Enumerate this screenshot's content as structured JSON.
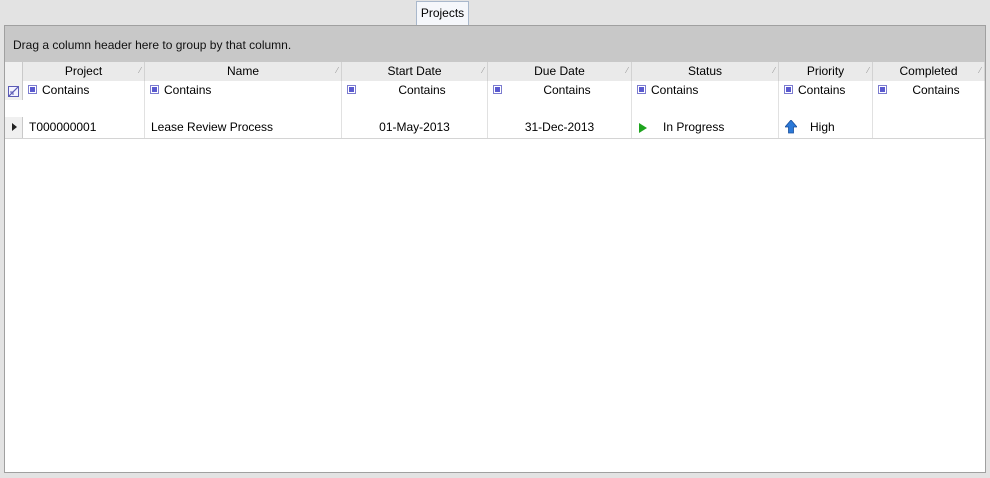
{
  "tabs": [
    "Projects"
  ],
  "group_panel": {
    "text": "Drag a column header here to group by that column."
  },
  "grid": {
    "columns": [
      "Project",
      "Name",
      "Start Date",
      "Due Date",
      "Status",
      "Priority",
      "Completed"
    ],
    "filter_operators": [
      "Contains",
      "Contains",
      "Contains",
      "Contains",
      "Contains",
      "Contains",
      "Contains"
    ],
    "rows": [
      {
        "project": "T000000001",
        "name": "Lease Review Process",
        "start_date": "01-May-2013",
        "due_date": "31-Dec-2013",
        "status": "In Progress",
        "status_icon": "play-icon",
        "priority": "High",
        "priority_icon": "up-arrow-icon",
        "completed": ""
      }
    ]
  },
  "colors": {
    "status_green": "#1ea41e",
    "priority_blue": "#2b79d8",
    "filter_purple": "#5a5ad0"
  }
}
